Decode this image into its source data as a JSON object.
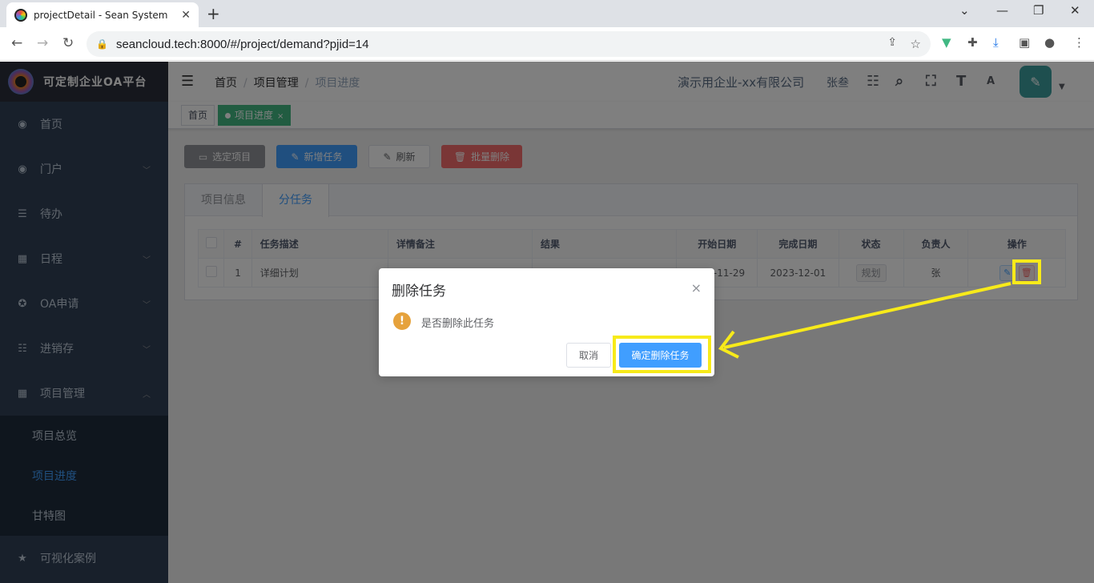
{
  "browser": {
    "tab_title": "projectDetail - Sean System",
    "url": "seancloud.tech:8000/#/project/demand?pjid=14"
  },
  "sidebar": {
    "app_name": "可定制企业OA平台",
    "items": [
      {
        "label": "首页",
        "icon": "dashboard-icon"
      },
      {
        "label": "门户",
        "icon": "dashboard-icon"
      },
      {
        "label": "待办",
        "icon": "list-icon"
      },
      {
        "label": "日程",
        "icon": "grid-icon"
      },
      {
        "label": "OA申请",
        "icon": "compass-icon"
      },
      {
        "label": "进销存",
        "icon": "tree-icon"
      },
      {
        "label": "项目管理",
        "icon": "table-icon"
      }
    ],
    "sub_items": [
      {
        "label": "项目总览"
      },
      {
        "label": "项目进度"
      },
      {
        "label": "甘特图"
      }
    ],
    "last_item": "可视化案例"
  },
  "header": {
    "breadcrumb": [
      "首页",
      "项目管理",
      "项目进度"
    ],
    "company": "演示用企业-xx有限公司",
    "user": "张叁"
  },
  "tags": {
    "home": "首页",
    "current": "项目进度",
    "close": "×"
  },
  "toolbar": {
    "select_project": "选定项目",
    "new_task": "新增任务",
    "refresh": "刷新",
    "batch_delete": "批量删除"
  },
  "tabs": [
    "项目信息",
    "分任务"
  ],
  "table": {
    "headers": [
      "#",
      "任务描述",
      "详情备注",
      "结果",
      "开始日期",
      "完成日期",
      "状态",
      "负责人",
      "操作"
    ],
    "rows": [
      {
        "index": "1",
        "desc": "详细计划",
        "remark": "",
        "result": "",
        "start": "2023-11-29",
        "end": "2023-12-01",
        "status": "规划",
        "owner": "张"
      }
    ]
  },
  "dialog": {
    "title": "删除任务",
    "close": "×",
    "message": "是否删除此任务",
    "cancel": "取消",
    "confirm": "确定删除任务"
  },
  "colors": {
    "primary": "#409eff",
    "danger": "#f56c6c",
    "success": "#42b983",
    "sidebar": "#304156",
    "highlight": "#f7ea1a"
  }
}
